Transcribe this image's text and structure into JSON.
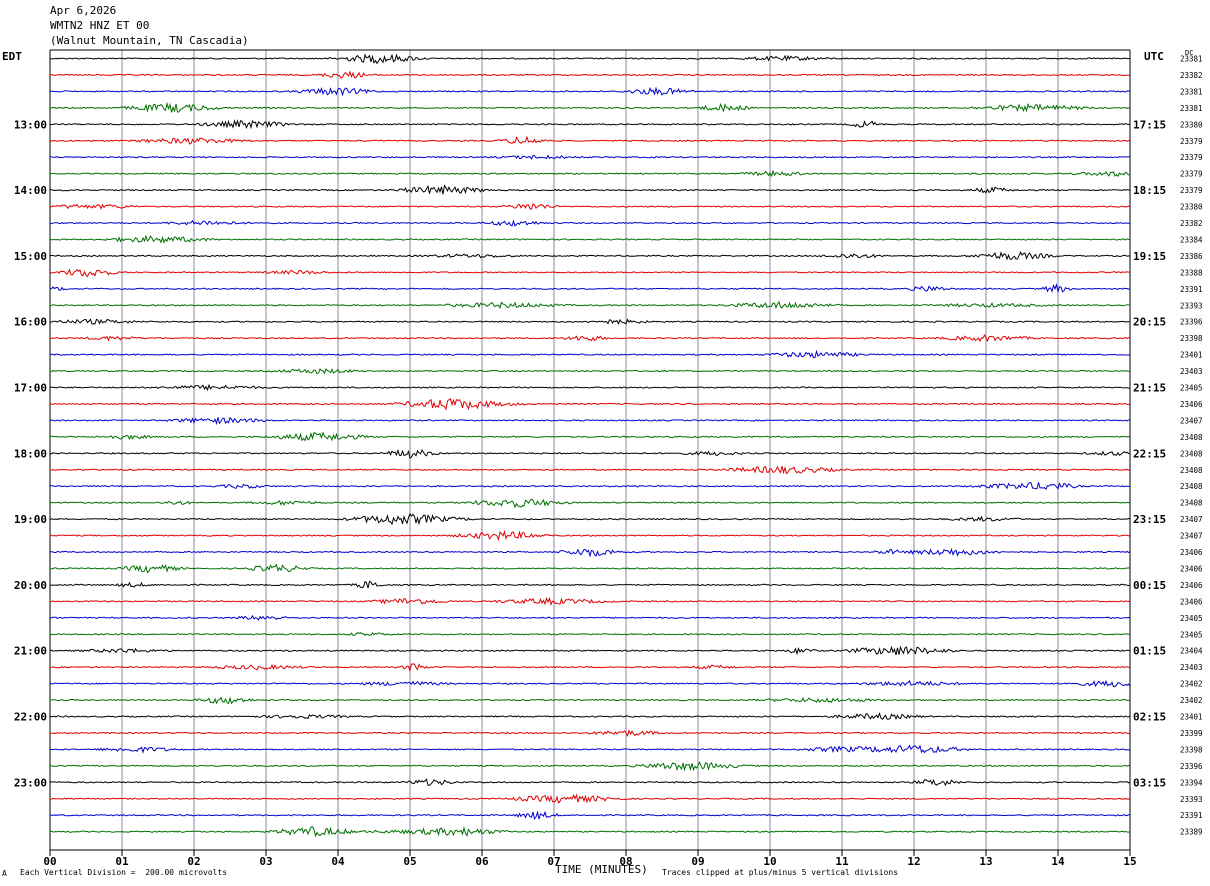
{
  "header": {
    "date": "Apr 6,2026",
    "station": "WMTN2 HNZ ET 00",
    "location": "(Walnut Mountain, TN Cascadia)"
  },
  "labels": {
    "left_tz": "EDT",
    "right_tz": "UTC",
    "dc": "DC",
    "footer_left": "Each Vertical Division =  200.00 microvolts",
    "footer_right": "Traces clipped at plus/minus 5 vertical divisions",
    "footer_mark": "A"
  },
  "colors": {
    "trace_cycle": [
      "#000000",
      "#e00000",
      "#0000d0",
      "#007000"
    ],
    "grid": "#8a8aa0"
  },
  "chart_data": {
    "type": "line",
    "xlabel": "TIME (MINUTES)",
    "xlim": [
      0,
      15
    ],
    "x_ticks": [
      "00",
      "01",
      "02",
      "03",
      "04",
      "05",
      "06",
      "07",
      "08",
      "09",
      "10",
      "11",
      "12",
      "13",
      "14",
      "15"
    ],
    "num_traces": 48,
    "left_hour_labels": [
      "13:00",
      "14:00",
      "15:00",
      "16:00",
      "17:00",
      "18:00",
      "19:00",
      "20:00",
      "21:00",
      "22:00",
      "23:00"
    ],
    "right_hour_labels": [
      "17:15",
      "18:15",
      "19:15",
      "20:15",
      "21:15",
      "22:15",
      "23:15",
      "00:15",
      "01:15",
      "02:15",
      "03:15"
    ],
    "dc_offsets": [
      23381,
      23382,
      23381,
      23381,
      23380,
      23379,
      23379,
      23379,
      23379,
      23380,
      23382,
      23384,
      23386,
      23388,
      23391,
      23393,
      23396,
      23398,
      23401,
      23403,
      23405,
      23406,
      23407,
      23408,
      23408,
      23408,
      23408,
      23408,
      23407,
      23407,
      23406,
      23406,
      23406,
      23406,
      23405,
      23405,
      23404,
      23403,
      23402,
      23402,
      23401,
      23399,
      23398,
      23396,
      23394,
      23393,
      23391,
      23389
    ]
  }
}
